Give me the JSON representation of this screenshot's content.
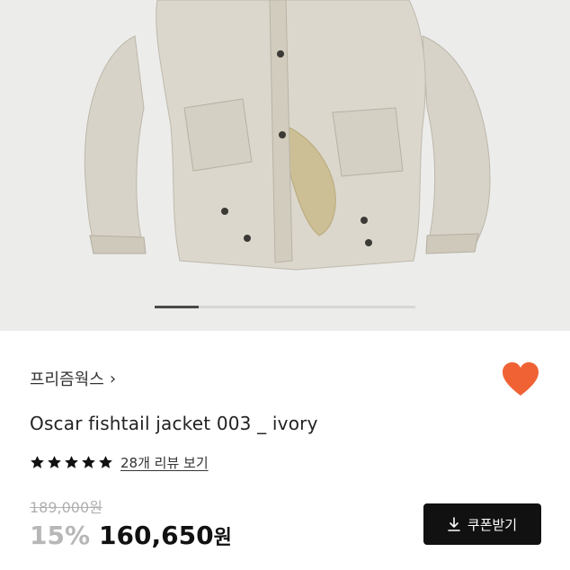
{
  "product": {
    "brand": "프리즘웍스",
    "title": "Oscar fishtail jacket 003 _ ivory",
    "rating": 5,
    "review_link": "28개 리뷰 보기",
    "original_price": "189,000원",
    "discount": "15%",
    "price": "160,650",
    "currency": "원",
    "wishlisted": true
  },
  "carousel": {
    "active_fraction": 0.17
  },
  "coupon": {
    "label": "쿠폰받기",
    "icon": "download-icon"
  },
  "colors": {
    "heart": "#f06234",
    "button_bg": "#111111",
    "discount": "#b7b7b7",
    "strikethrough": "#b0b0b0"
  }
}
